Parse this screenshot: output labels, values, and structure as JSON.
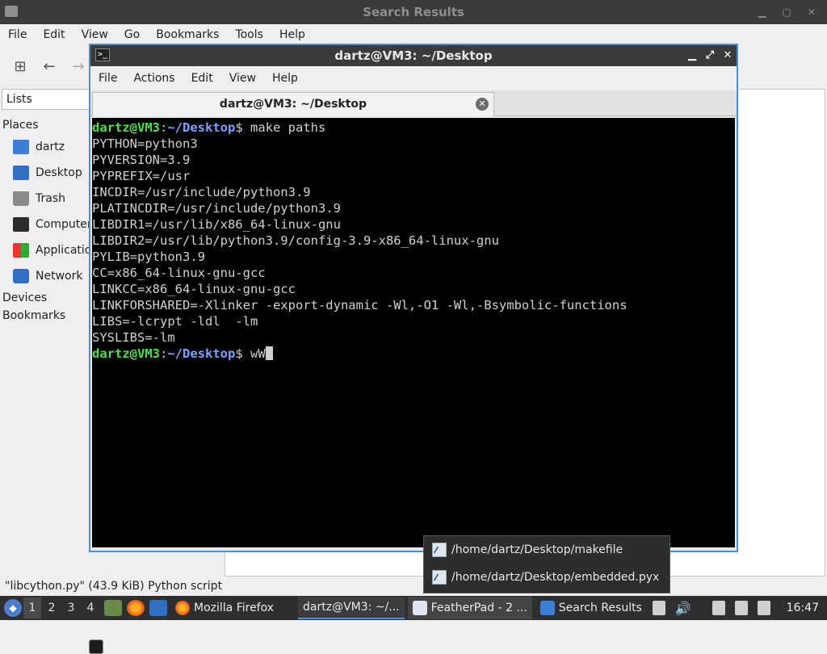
{
  "file_manager": {
    "title": "Search Results",
    "menu": [
      "File",
      "Edit",
      "View",
      "Go",
      "Bookmarks",
      "Tools",
      "Help"
    ],
    "side_combo": "Lists",
    "places_header": "Places",
    "places": [
      {
        "label": "dartz",
        "icon": "home-folder-icon"
      },
      {
        "label": "Desktop",
        "icon": "desktop-icon"
      },
      {
        "label": "Trash",
        "icon": "trash-icon"
      },
      {
        "label": "Computer",
        "icon": "computer-icon"
      },
      {
        "label": "Applications",
        "icon": "applications-icon"
      },
      {
        "label": "Network",
        "icon": "network-icon"
      }
    ],
    "devices_header": "Devices",
    "bookmarks_header": "Bookmarks",
    "status": "\"libcython.py\" (43.9 KiB) Python script"
  },
  "terminal": {
    "title": "dartz@VM3: ~/Desktop",
    "menu": [
      "File",
      "Actions",
      "Edit",
      "View",
      "Help"
    ],
    "tab_label": "dartz@VM3: ~/Desktop",
    "prompt_user": "dartz@VM3",
    "prompt_sep": ":",
    "prompt_path": "~/Desktop",
    "prompt_end": "$ ",
    "command": "make paths",
    "output": [
      "PYTHON=python3",
      "PYVERSION=3.9",
      "PYPREFIX=/usr",
      "INCDIR=/usr/include/python3.9",
      "PLATINCDIR=/usr/include/python3.9",
      "LIBDIR1=/usr/lib/x86_64-linux-gnu",
      "LIBDIR2=/usr/lib/python3.9/config-3.9-x86_64-linux-gnu",
      "PYLIB=python3.9",
      "CC=x86_64-linux-gnu-gcc",
      "LINKCC=x86_64-linux-gnu-gcc",
      "LINKFORSHARED=-Xlinker -export-dynamic -Wl,-O1 -Wl,-Bsymbolic-functions",
      "LIBS=-lcrypt -ldl  -lm",
      "SYSLIBS=-lm"
    ],
    "current_input": "wW"
  },
  "popup": {
    "items": [
      "/home/dartz/Desktop/makefile",
      "/home/dartz/Desktop/embedded.pyx"
    ]
  },
  "taskbar": {
    "workspaces": [
      "1",
      "2",
      "3",
      "4"
    ],
    "tasks": [
      {
        "label": "Mozilla Firefox",
        "icon": "firefox-icon"
      },
      {
        "label": "dartz@VM3: ~/...",
        "icon": "terminal-icon"
      },
      {
        "label": "FeatherPad - 2 ...",
        "icon": "featherpad-icon"
      },
      {
        "label": "Search Results",
        "icon": "folder-icon"
      }
    ],
    "clock": "16:47"
  }
}
